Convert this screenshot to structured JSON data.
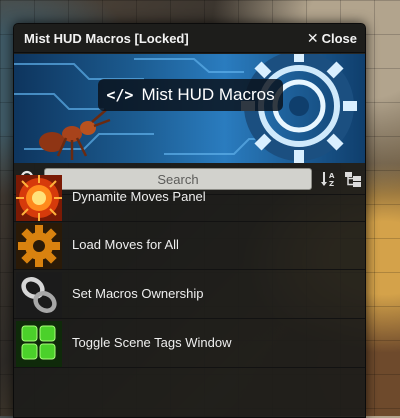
{
  "window": {
    "title": "Mist HUD Macros [Locked]",
    "close_label": "Close"
  },
  "banner": {
    "title": "Mist HUD Macros"
  },
  "search": {
    "placeholder": "Search"
  },
  "macros": [
    {
      "label": "Dynamite Moves Panel",
      "icon": "explosion-icon"
    },
    {
      "label": "Load Moves for All",
      "icon": "gear-icon"
    },
    {
      "label": "Set Macros Ownership",
      "icon": "chain-links-icon"
    },
    {
      "label": "Toggle Scene Tags Window",
      "icon": "grid-tiles-icon"
    }
  ]
}
